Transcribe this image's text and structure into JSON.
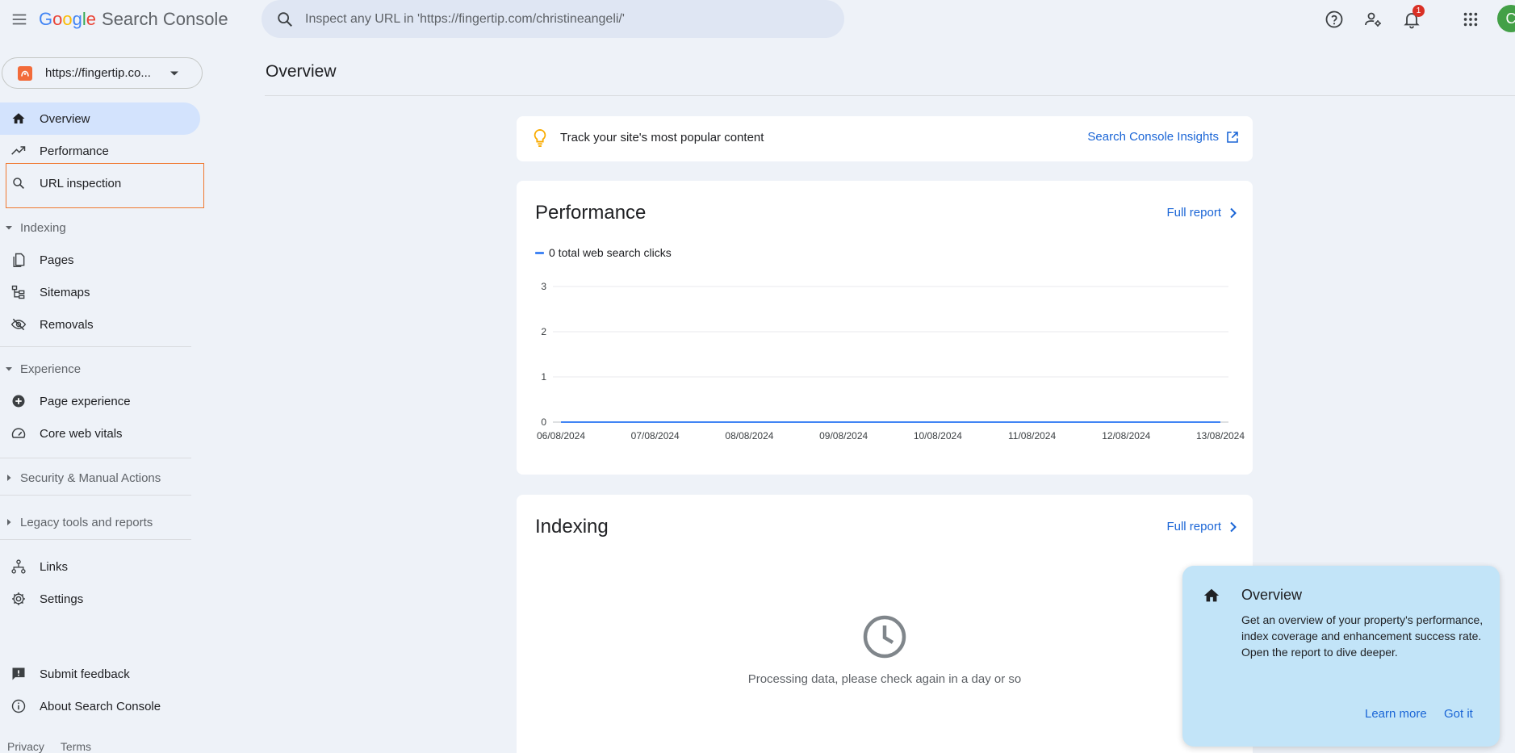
{
  "header": {
    "logo_letters": [
      "G",
      "o",
      "o",
      "g",
      "l",
      "e"
    ],
    "product_name": "Search Console",
    "search_placeholder": "Inspect any URL in 'https://fingertip.com/christineangeli/'",
    "notification_count": "1",
    "avatar_initial": "C",
    "icons": [
      "menu-icon",
      "search-icon",
      "help-icon",
      "manage-users-icon",
      "notifications-icon",
      "apps-grid-icon"
    ]
  },
  "property": {
    "label": "https://fingertip.co..."
  },
  "sidebar": {
    "items": [
      {
        "label": "Overview",
        "icon": "home-icon"
      },
      {
        "label": "Performance",
        "icon": "trending-up-icon"
      },
      {
        "label": "URL inspection",
        "icon": "search-icon"
      }
    ],
    "indexing": {
      "title": "Indexing",
      "items": [
        {
          "label": "Pages",
          "icon": "pages-icon"
        },
        {
          "label": "Sitemaps",
          "icon": "sitemap-icon"
        },
        {
          "label": "Removals",
          "icon": "eye-off-icon"
        }
      ]
    },
    "experience": {
      "title": "Experience",
      "items": [
        {
          "label": "Page experience",
          "icon": "add-circle-icon"
        },
        {
          "label": "Core web vitals",
          "icon": "speed-icon"
        }
      ]
    },
    "security_title": "Security & Manual Actions",
    "legacy_title": "Legacy tools and reports",
    "bottom_items": [
      {
        "label": "Links",
        "icon": "links-icon"
      },
      {
        "label": "Settings",
        "icon": "gear-icon"
      }
    ],
    "feedback_items": [
      {
        "label": "Submit feedback",
        "icon": "feedback-icon"
      },
      {
        "label": "About Search Console",
        "icon": "info-icon"
      }
    ],
    "footer": {
      "privacy": "Privacy",
      "terms": "Terms"
    }
  },
  "main": {
    "title": "Overview",
    "tip": {
      "text": "Track your site's most popular content",
      "link": "Search Console Insights"
    },
    "performance": {
      "title": "Performance",
      "full_report": "Full report",
      "legend": "0 total web search clicks"
    },
    "indexing": {
      "title": "Indexing",
      "full_report": "Full report",
      "processing": "Processing data, please check again in a day or so"
    }
  },
  "chart_data": {
    "type": "line",
    "x": [
      "06/08/2024",
      "07/08/2024",
      "08/08/2024",
      "09/08/2024",
      "10/08/2024",
      "11/08/2024",
      "12/08/2024",
      "13/08/2024"
    ],
    "series": [
      {
        "name": "0 total web search clicks",
        "values": [
          0,
          0,
          0,
          0,
          0,
          0,
          0,
          0
        ],
        "color": "#4285f4"
      }
    ],
    "y_ticks": [
      0,
      1,
      2,
      3
    ],
    "ylim": [
      0,
      3
    ],
    "grid": true,
    "legend_position": "top-left"
  },
  "popup": {
    "title": "Overview",
    "body": "Get an overview of your property's performance, index coverage and enhancement success rate. Open the report to dive deeper.",
    "learn_more": "Learn more",
    "got_it": "Got it"
  },
  "colors": {
    "accent_blue": "#1a65d6",
    "active_nav": "#d3e3fd",
    "highlight_orange": "#f0782f",
    "popup_bg": "#c2e4f8",
    "badge_red": "#d93025",
    "avatar_green": "#43a047"
  }
}
